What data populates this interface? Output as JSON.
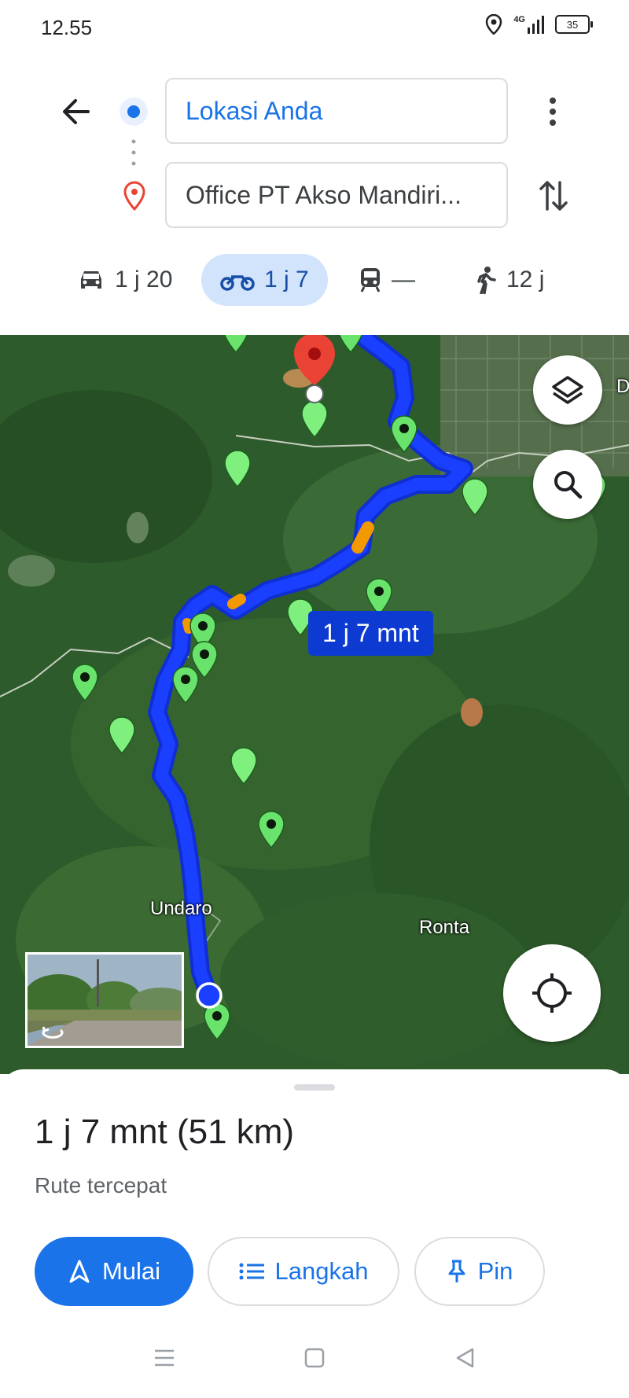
{
  "status_bar": {
    "time": "12.55",
    "network": "4G",
    "battery": "35"
  },
  "search": {
    "origin": "Lokasi Anda",
    "destination": "Office PT Akso Mandiri..."
  },
  "modes": [
    {
      "icon": "car-icon",
      "label": "1 j 20"
    },
    {
      "icon": "motorcycle-icon",
      "label": "1 j 7",
      "active": true
    },
    {
      "icon": "train-icon",
      "label": "—"
    },
    {
      "icon": "walk-icon",
      "label": "12 j"
    }
  ],
  "map": {
    "duration_chip": "1 j 7 mnt",
    "places": [
      "Undaro",
      "Ronta"
    ],
    "edge_label": "D"
  },
  "sheet": {
    "summary": "1 j 7 mnt (51 km)",
    "subtitle": "Rute tercepat",
    "buttons": {
      "start": "Mulai",
      "steps": "Langkah",
      "pin": "Pin"
    }
  },
  "colors": {
    "accent": "#1a73e8",
    "route": "#1a3fff",
    "pin_green": "#69e36b",
    "destination_red": "#ea4335"
  }
}
